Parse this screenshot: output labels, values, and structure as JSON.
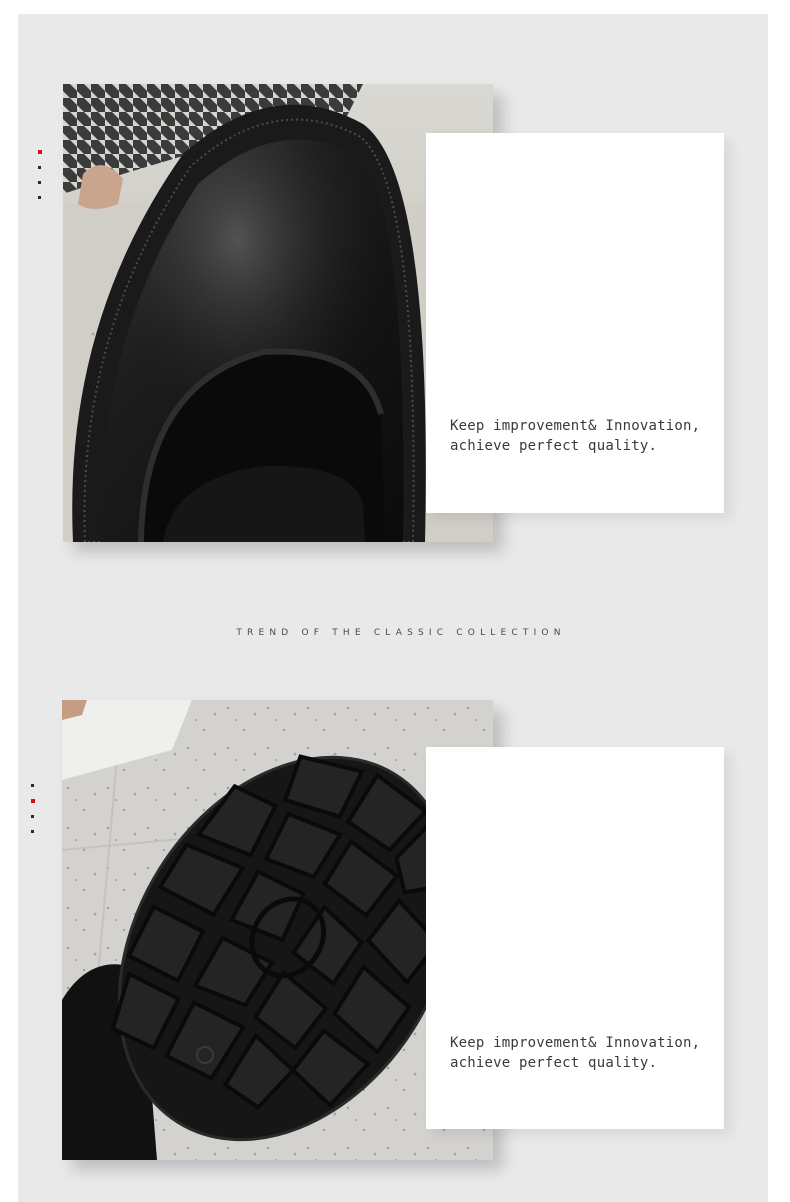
{
  "section_one": {
    "caption_line1": "Keep improvement& Innovation,",
    "caption_line2": "achieve perfect quality.",
    "image": "shoe-toe-closeup-photo"
  },
  "tagline": "TREND OF THE CLASSIC COLLECTION",
  "section_two": {
    "caption_line1": "Keep improvement& Innovation,",
    "caption_line2": "achieve perfect quality.",
    "image": "shoe-sole-tread-photo"
  },
  "colors": {
    "background": "#e9e9ea",
    "accent_dot": "#d40f14",
    "text": "#3a3a3a",
    "leather": "#141414"
  }
}
